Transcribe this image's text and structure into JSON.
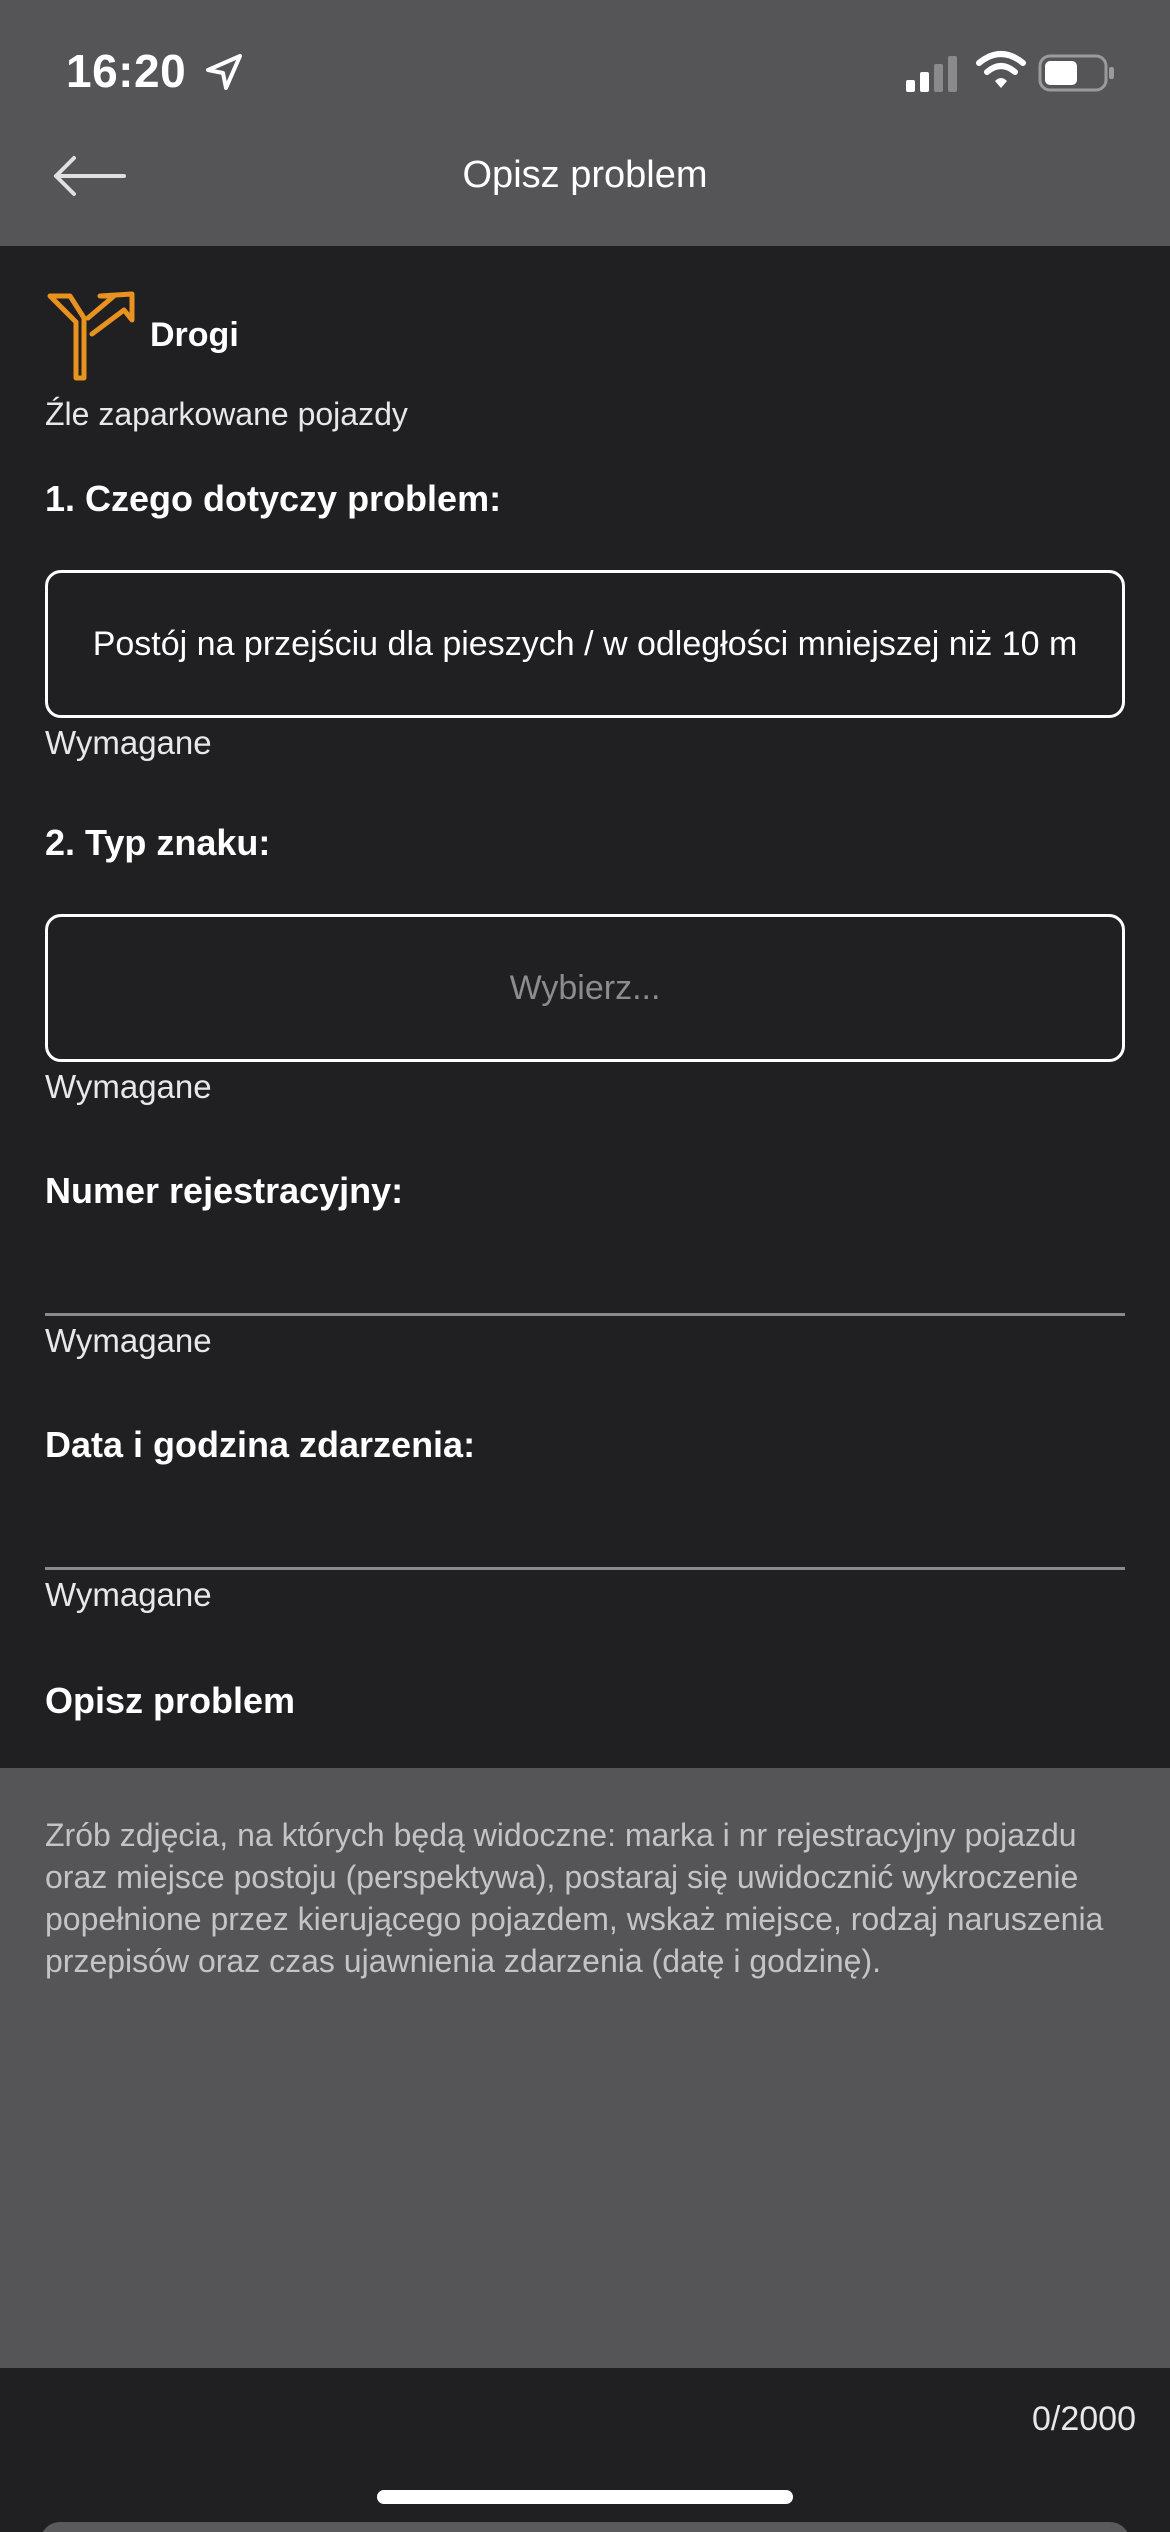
{
  "status_bar": {
    "time": "16:20"
  },
  "header": {
    "title": "Opisz problem"
  },
  "category": {
    "name": "Drogi",
    "subcategory": "Źle zaparkowane pojazdy",
    "accent_color": "#E8921F"
  },
  "form": {
    "q1": {
      "title": "1. Czego dotyczy problem:",
      "value": "Postój na przejściu dla pieszych / w odległości mniejszej niż 10 m",
      "required": "Wymagane"
    },
    "q2": {
      "title": "2. Typ znaku:",
      "placeholder": "Wybierz...",
      "required": "Wymagane"
    },
    "plate": {
      "title": "Numer rejestracyjny:",
      "value": "",
      "required": "Wymagane"
    },
    "datetime": {
      "title": "Data i godzina zdarzenia:",
      "value": "",
      "required": "Wymagane"
    },
    "description": {
      "title": "Opisz problem",
      "placeholder": "Zrób zdjęcia, na których będą widoczne: marka i nr rejestracyjny pojazdu oraz miejsce postoju (perspektywa), postaraj się uwidocznić wykroczenie popełnione przez kierującego pojazdem, wskaż miejsce, rodzaj naruszenia przepisów oraz czas ujawnienia zdarzenia (datę i godzinę).",
      "counter": "0/2000"
    }
  }
}
